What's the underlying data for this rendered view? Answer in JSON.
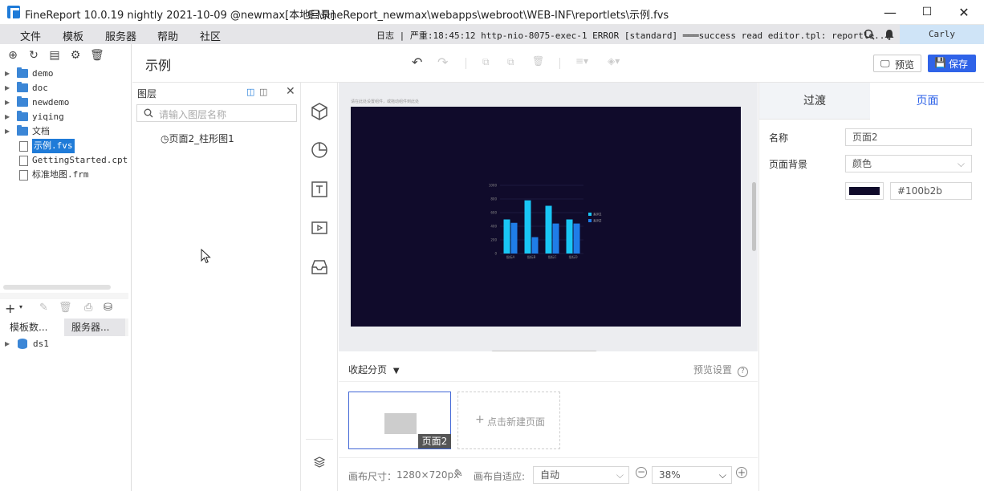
{
  "titlebar": {
    "title": "FineReport 10.0.19 nightly 2021-10-09 @newmax[本地目录]",
    "path": "E:\\FineReport_newmax\\webapps\\webroot\\WEB-INF\\reportlets\\示例.fvs",
    "minimize": "—",
    "maximize": "☐",
    "close": "✕"
  },
  "menubar": {
    "items": [
      "文件",
      "模板",
      "服务器",
      "帮助",
      "社区"
    ],
    "log": "日志 | 严重:18:45:12 http-nio-8075-exec-1 ERROR [standard] ═══success read editor.tpl: reportle...",
    "user": "Carly"
  },
  "tree": {
    "items": [
      {
        "label": "demo",
        "type": "folder"
      },
      {
        "label": "doc",
        "type": "folder"
      },
      {
        "label": "newdemo",
        "type": "folder"
      },
      {
        "label": "yiqing",
        "type": "folder"
      },
      {
        "label": "文档",
        "type": "folder"
      },
      {
        "label": "示例.fvs",
        "type": "file",
        "selected": true
      },
      {
        "label": "GettingStarted.cpt",
        "type": "file"
      },
      {
        "label": "标准地图.frm",
        "type": "file"
      }
    ]
  },
  "datasource": {
    "tabs": [
      "模板数...",
      "服务器..."
    ],
    "items": [
      "ds1"
    ]
  },
  "header": {
    "page_title": "示例",
    "preview_label": "预览",
    "save_label": "保存"
  },
  "layers": {
    "title": "图层",
    "search_placeholder": "请输入图层名称",
    "items": [
      "页面2_柱形图1"
    ]
  },
  "canvas": {
    "bg_color": "#100b2b",
    "caption": "请在此处设置组件，或拖动组件到此处"
  },
  "chart_data": {
    "type": "bar",
    "categories": [
      "指标A",
      "指标B",
      "指标C",
      "指标D"
    ],
    "series": [
      {
        "name": "系列1",
        "values": [
          500,
          780,
          700,
          500
        ]
      },
      {
        "name": "系列2",
        "values": [
          450,
          240,
          440,
          440
        ]
      }
    ],
    "ylim": [
      0,
      1000
    ],
    "yticks": [
      "0",
      "200",
      "400",
      "600",
      "800",
      "1000"
    ],
    "colors": [
      "#19c6f5",
      "#1f7de8"
    ],
    "legend": "right"
  },
  "paging": {
    "collapse_label": "收起分页",
    "preview_settings": "预览设置",
    "page_label": "页面2",
    "new_page_label": "点击新建页面"
  },
  "footer": {
    "canvas_size_label": "画布尺寸：",
    "canvas_size": "1280×720px",
    "fit_label": "画布自适应:",
    "fit_value": "自动",
    "zoom": "38%"
  },
  "rightpanel": {
    "tabs": [
      "过渡",
      "页面"
    ],
    "name_label": "名称",
    "name_value": "页面2",
    "bg_label": "页面背景",
    "bg_type": "颜色",
    "color_hex": "#100b2b"
  }
}
